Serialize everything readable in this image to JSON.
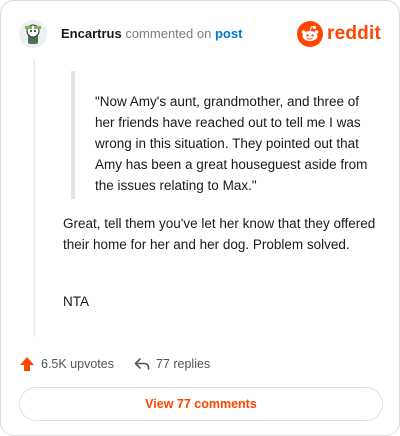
{
  "header": {
    "username": "Encartrus",
    "action_text": "commented on",
    "post_link": "post",
    "brand_name": "reddit"
  },
  "comment": {
    "quote_text": "\"Now Amy's aunt, grandmother, and three of her friends have reached out to tell me I was wrong in this situation. They pointed out that Amy has been a great houseguest aside from the issues relating to Max.\"",
    "body_text": "Great, tell them you've let her know that they offered their home for her and her dog. Problem solved.",
    "verdict_text": "NTA"
  },
  "actions": {
    "upvotes_label": "6.5K upvotes",
    "replies_label": "77 replies",
    "view_comments_label": "View 77 comments"
  },
  "colors": {
    "brand_orange": "#ff4500",
    "link_blue": "#0079d3",
    "text": "#1a1a1b",
    "muted": "#7c7c7c"
  },
  "icons": {
    "avatar": "snoo-avatar",
    "brand": "reddit-logo",
    "upvote": "upvote-arrow-icon",
    "reply": "reply-arrow-icon"
  }
}
